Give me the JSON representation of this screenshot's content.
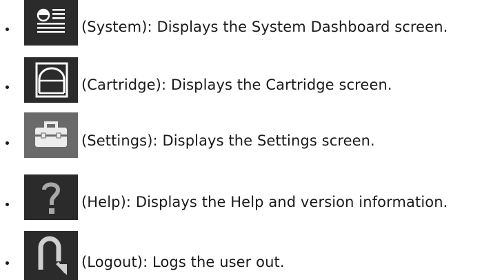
{
  "items": [
    {
      "icon": "system-dashboard-icon",
      "label": "(System)",
      "description": ": Displays the System Dashboard screen."
    },
    {
      "icon": "cartridge-icon",
      "label": "(Cartridge)",
      "description": ": Displays the Cartridge screen."
    },
    {
      "icon": "toolbox-icon",
      "label": "(Settings)",
      "description": ": Displays the Settings screen."
    },
    {
      "icon": "question-mark-icon",
      "label": "(Help)",
      "description": ": Displays the Help and version information."
    },
    {
      "icon": "logout-arrow-icon",
      "label": "(Logout)",
      "description": ": Logs the user out."
    }
  ],
  "colors": {
    "icon_background": "#2b2b2b",
    "settings_icon_background": "#6a6a6a",
    "icon_foreground": "#ffffff",
    "text": "#1a1a1a"
  }
}
